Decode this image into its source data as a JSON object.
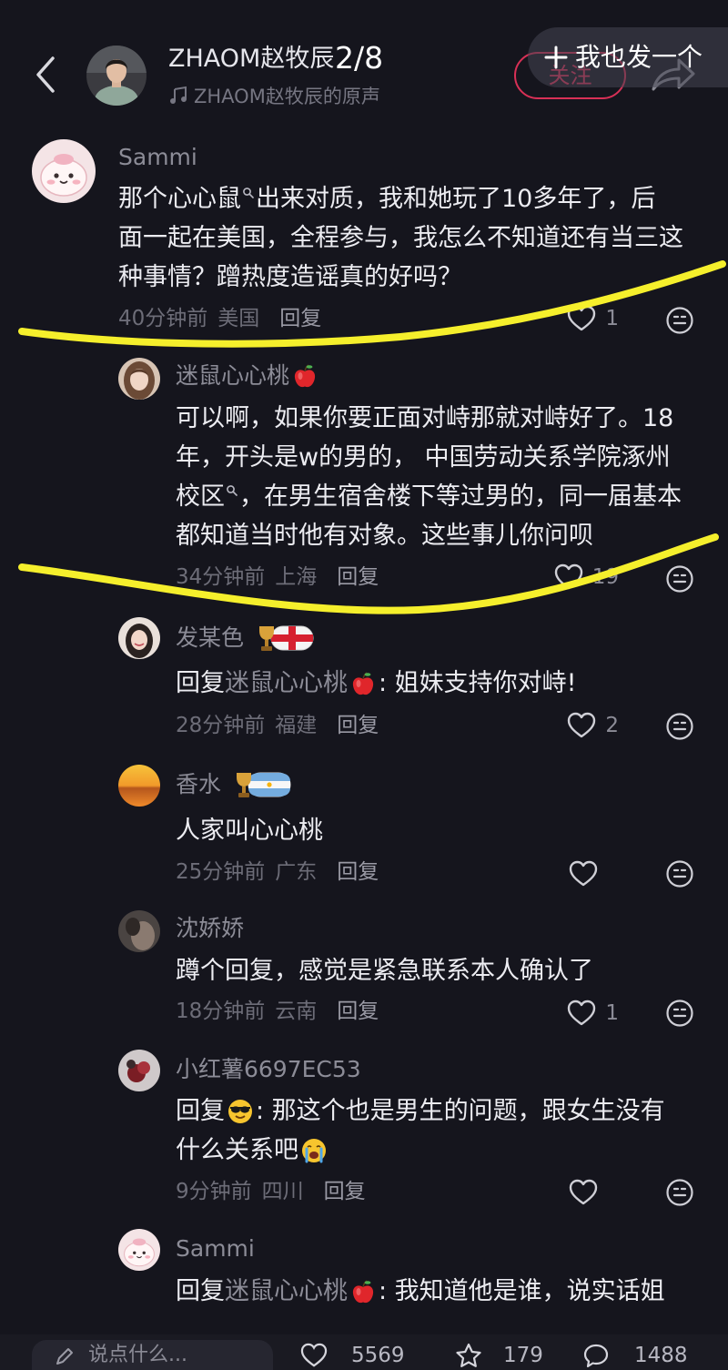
{
  "header": {
    "title": "ZHAOM赵牧辰",
    "page_indicator": "2/8",
    "audio_label": "ZHAOM赵牧辰的原声",
    "follow_label": "关注",
    "post_too_label": "我也发一个"
  },
  "comments": [
    {
      "name": "Sammi",
      "lines": [
        [
          "那个 ",
          "心心鼠",
          " 出来对质，我和她玩了10多年了，后"
        ],
        [
          "面一起在美国，全程参与，我怎么不知道还有当三这"
        ],
        [
          "种事情？蹭热度造谣真的好吗？"
        ]
      ],
      "time": "40分钟前",
      "location": "美国",
      "reply_label": "回复",
      "likes": "1"
    },
    {
      "name": "迷鼠心心桃",
      "lines": [
        [
          "可以啊，如果你要正面对峙那就对峙好了。18"
        ],
        [
          "年，开头是w的男的， 中国劳动关系学院涿州"
        ],
        [
          "校区",
          "，在男生宿舍楼下等过男的，同一届基本"
        ],
        [
          "都知道当时他有对象。这些事儿你问呗"
        ]
      ],
      "time": "34分钟前",
      "location": "上海",
      "reply_label": "回复",
      "likes": "19"
    },
    {
      "name": "发某色",
      "lines": [
        [
          "回复 ",
          "迷鼠心心桃",
          ": 姐妹支持你对峙!"
        ]
      ],
      "time": "28分钟前",
      "location": "福建",
      "reply_label": "回复",
      "likes": "2"
    },
    {
      "name": "香水",
      "lines": [
        [
          "人家叫心心桃"
        ]
      ],
      "time": "25分钟前",
      "location": "广东",
      "reply_label": "回复"
    },
    {
      "name": "沈娇娇",
      "lines": [
        [
          "蹲个回复，感觉是紧急联系本人确认了"
        ]
      ],
      "time": "18分钟前",
      "location": "云南",
      "reply_label": "回复",
      "likes": "1"
    },
    {
      "name": "小红薯6697EC53",
      "lines": [
        [
          "回复 ",
          ": 那这个也是男生的问题，跟女生没有"
        ],
        [
          "什么关系吧"
        ]
      ],
      "time": "9分钟前",
      "location": "四川",
      "reply_label": "回复"
    },
    {
      "name": "Sammi",
      "lines": [
        [
          "回复 ",
          "迷鼠心心桃",
          ": 我知道他是谁，说实话姐"
        ]
      ]
    }
  ],
  "bottom_bar": {
    "placeholder": "说点什么...",
    "like_count": "5569",
    "favorite_count": "179",
    "comment_count": "1488"
  },
  "icons": {
    "back": "chevron-left-icon",
    "audio": "music-note-icon",
    "post_too": "plus-icon",
    "share": "share-arrow-icon",
    "like": "heart-icon",
    "react": "emoji-face-icon",
    "keyword": "search-link-icon",
    "name_badge": "apple-emoji-icon",
    "badges": [
      "trophy-england-flag-icon",
      "trophy-argentina-flag-icon"
    ],
    "inline_emoji": [
      "sunglasses-emoji-icon",
      "crying-emoji-icon"
    ],
    "input": "pencil-icon",
    "favorite": "star-icon",
    "comment": "comment-bubble-icon"
  },
  "colors": {
    "background": "#15151d",
    "follow_accent": "#e0325a",
    "annotation_underline": "#f5ef2c"
  }
}
